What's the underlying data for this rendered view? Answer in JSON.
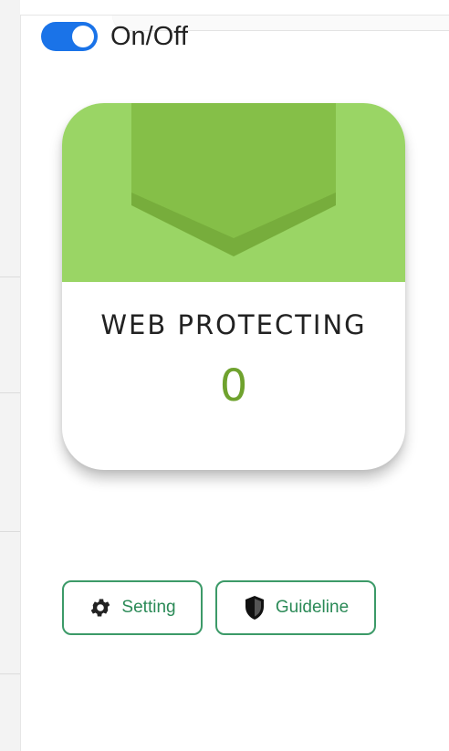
{
  "toggle": {
    "state": "on",
    "label": "On/Off",
    "color": "#1a73e8"
  },
  "card": {
    "title": "WEB PROTECTING",
    "count": "0",
    "header_color": "#9ad565",
    "icon": "shield-icon"
  },
  "buttons": {
    "setting": {
      "label": "Setting",
      "icon": "gear-icon"
    },
    "guideline": {
      "label": "Guideline",
      "icon": "shield-icon"
    }
  },
  "colors": {
    "accent_green": "#3c9a68",
    "count_green": "#6fa22e"
  }
}
